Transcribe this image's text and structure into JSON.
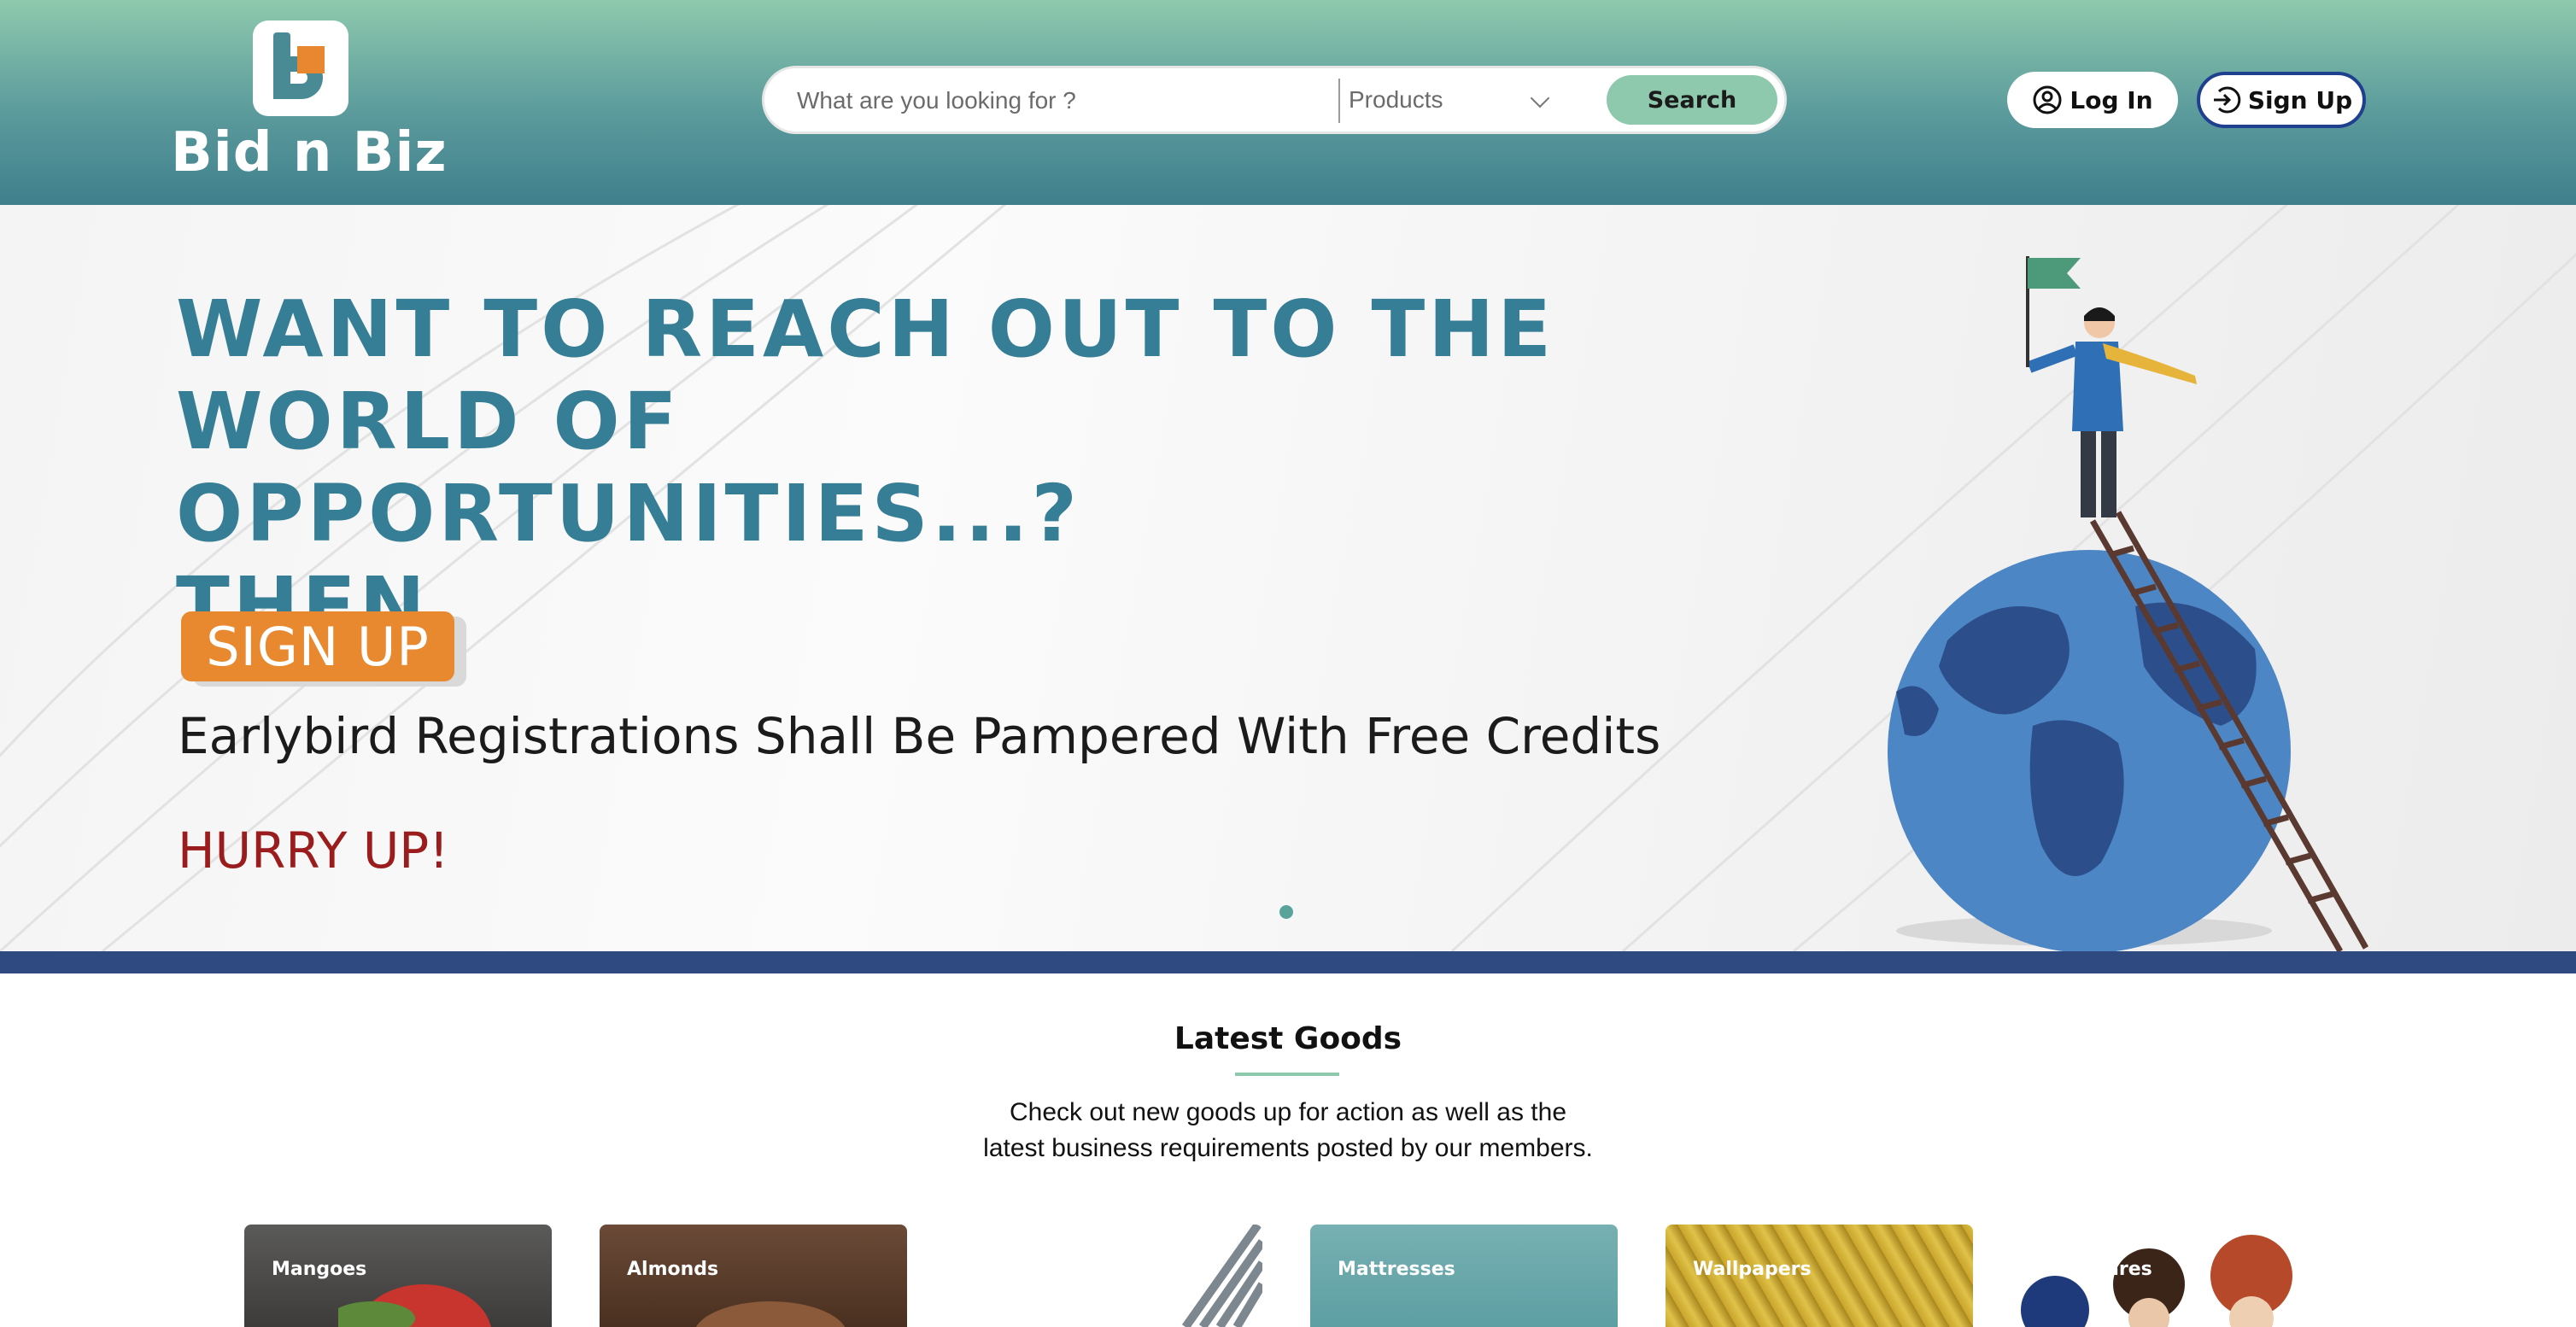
{
  "brand": {
    "name": "Bid n Biz"
  },
  "search": {
    "placeholder": "What are you looking for ?",
    "category": "Products",
    "button": "Search"
  },
  "auth": {
    "login": "Log In",
    "signup": "Sign Up"
  },
  "hero": {
    "title": "WANT TO REACH OUT TO THE WORLD OF\nOPPORTUNITIES...?\nTHEN",
    "signup_badge": "SIGN UP",
    "subtitle": "Earlybird Registrations Shall Be Pampered With Free Credits",
    "cta": "HURRY UP!"
  },
  "latest_goods": {
    "title": "Latest Goods",
    "description_line1": "Check out new goods up for action as well as the",
    "description_line2": "latest business requirements posted by our members.",
    "cards": [
      {
        "label": "Mangoes"
      },
      {
        "label": "Almonds"
      },
      {
        "label": ""
      },
      {
        "label": "Mattresses"
      },
      {
        "label": "Wallpapers"
      },
      {
        "label": "ares"
      }
    ]
  },
  "colors": {
    "accent_green": "#8ec9ad",
    "teal_text": "#357e95",
    "orange": "#e8892f",
    "navy": "#2e4a80",
    "hurry_red": "#9b1c1c"
  }
}
